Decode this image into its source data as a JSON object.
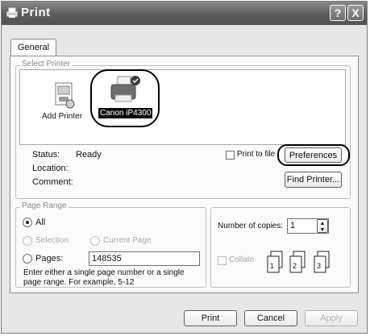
{
  "window": {
    "title": "Print",
    "help_glyph": "?",
    "close_glyph": "X"
  },
  "tabs": [
    {
      "label": "General",
      "selected": true
    }
  ],
  "select_printer": {
    "legend": "Select Printer",
    "items": [
      {
        "label": "Add Printer",
        "icon": "add-printer-icon",
        "selected": false
      },
      {
        "label": "Canon iP4300",
        "icon": "printer-icon",
        "selected": true
      }
    ]
  },
  "printer_info": {
    "status_label": "Status:",
    "status_value": "Ready",
    "location_label": "Location:",
    "location_value": "",
    "comment_label": "Comment:",
    "comment_value": ""
  },
  "print_to_file": {
    "label": "Print to file",
    "checked": false
  },
  "buttons": {
    "preferences": "Preferences",
    "find_printer": "Find Printer...",
    "print": "Print",
    "cancel": "Cancel",
    "apply": "Apply"
  },
  "page_range": {
    "legend": "Page Range",
    "all": "All",
    "selection": "Selection",
    "current_page": "Current Page",
    "pages": "Pages:",
    "selected": "all",
    "pages_value": "148535",
    "hint_line1": "Enter either a single page number or a single",
    "hint_line2": "page range.  For example, 5-12"
  },
  "copies": {
    "label": "Number of copies:",
    "value": "1",
    "collate_label": "Collate",
    "collate_checked": false,
    "page_glyphs": [
      "1",
      "2",
      "3"
    ]
  },
  "colors": {
    "highlight": "#1a1a1a",
    "title_bar": "#666666"
  }
}
